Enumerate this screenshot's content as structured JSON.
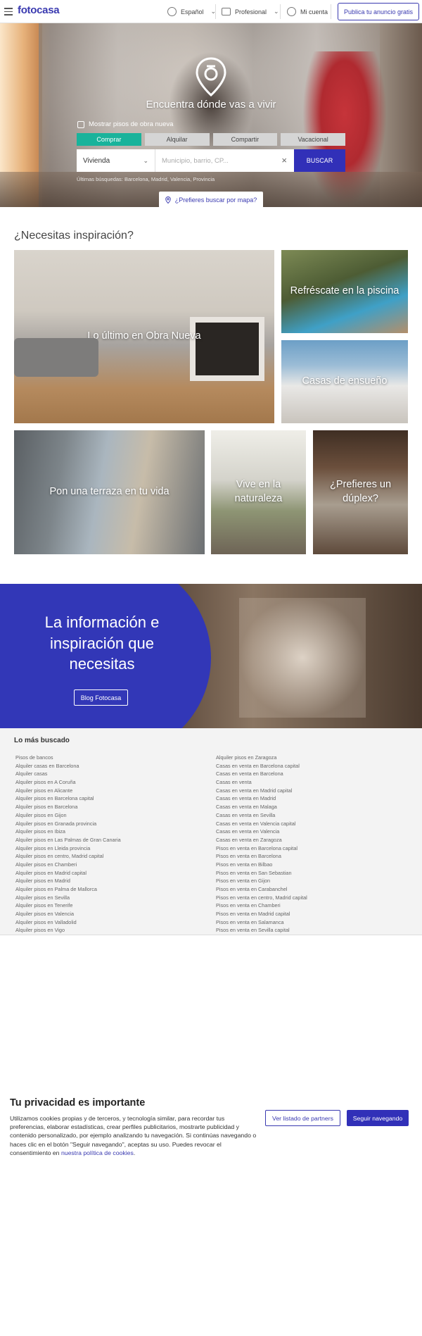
{
  "header": {
    "logo": "fotocasa",
    "language": "Español",
    "profesional": "Profesional",
    "mi_cuenta": "Mi cuenta",
    "publica": "Publica tu anuncio gratis"
  },
  "hero": {
    "title": "Encuentra dónde vas a vivir",
    "obra_nueva": "Mostrar pisos de obra nueva",
    "tabs": [
      "Comprar",
      "Alquilar",
      "Compartir",
      "Vacacional"
    ],
    "active_tab": "Comprar",
    "property_type": "Vivienda",
    "search_placeholder": "Municipio, barrio, CP...",
    "search_button": "BUSCAR",
    "recent_searches": "Últimas búsquedas: Barcelona, Madrid, Valencia, Provincia",
    "map_button": "¿Prefieres buscar por mapa?"
  },
  "inspiration": {
    "title": "¿Necesitas inspiración?",
    "cards": [
      "Lo último en Obra Nueva",
      "Refréscate en la piscina",
      "Casas de ensueño",
      "Pon una terraza en tu vida",
      "Vive en la naturaleza",
      "¿Prefieres un dúplex?"
    ]
  },
  "blog": {
    "title": "La información e inspiración que necesitas",
    "button": "Blog Fotocasa"
  },
  "mas_buscado": {
    "title": "Lo más buscado",
    "left": [
      "Pisos de bancos",
      "Alquiler casas en Barcelona",
      "Alquiler casas",
      "Alquiler pisos en A Coruña",
      "Alquiler pisos en Alicante",
      "Alquiler pisos en Barcelona capital",
      "Alquiler pisos en Barcelona",
      "Alquiler pisos en Gijon",
      "Alquiler pisos en Granada provincia",
      "Alquiler pisos en Ibiza",
      "Alquiler pisos en Las Palmas de Gran Canaria",
      "Alquiler pisos en Lleida provincia",
      "Alquiler pisos en centro, Madrid capital",
      "Alquiler pisos en Chamberi",
      "Alquiler pisos en Madrid capital",
      "Alquiler pisos en Madrid",
      "Alquiler pisos en Palma de Mallorca",
      "Alquiler pisos en Sevilla",
      "Alquiler pisos en Tenerife",
      "Alquiler pisos en Valencia",
      "Alquiler pisos en Valladolid",
      "Alquiler pisos en Vigo"
    ],
    "right": [
      "Alquiler pisos en Zaragoza",
      "Casas en venta en Barcelona capital",
      "Casas en venta en Barcelona",
      "Casas en venta",
      "Casas en venta en Madrid capital",
      "Casas en venta en Madrid",
      "Casas en venta en Malaga",
      "Casas en venta en Sevilla",
      "Casas en venta en Valencia capital",
      "Casas en venta en Valencia",
      "Casas en venta en Zaragoza",
      "Pisos en venta en Barcelona capital",
      "Pisos en venta en Barcelona",
      "Pisos en venta en Bilbao",
      "Pisos en venta en San Sebastian",
      "Pisos en venta en Gijon",
      "Pisos en venta en Carabanchel",
      "Pisos en venta en centro, Madrid capital",
      "Pisos en venta en Chamberi",
      "Pisos en venta en Madrid capital",
      "Pisos en venta en Salamanca",
      "Pisos en venta en Sevilla capital"
    ]
  },
  "cookie": {
    "title": "Tu privacidad es importante",
    "text": "Utilizamos cookies propias y de terceros, y tecnología similar, para recordar tus preferencias, elaborar estadísticas, crear perfiles publicitarios, mostrarte publicidad y contenido personalizado, por ejemplo analizando tu navegación. Si continúas navegando o haces clic en el botón \"Seguir navegando\", aceptas su uso. Puedes revocar el consentimiento en ",
    "link": "nuestra política de cookies",
    "partners_button": "Ver listado de partners",
    "accept_button": "Seguir navegando"
  },
  "colors": {
    "brand": "#3130b8",
    "accent": "#19b39b"
  }
}
